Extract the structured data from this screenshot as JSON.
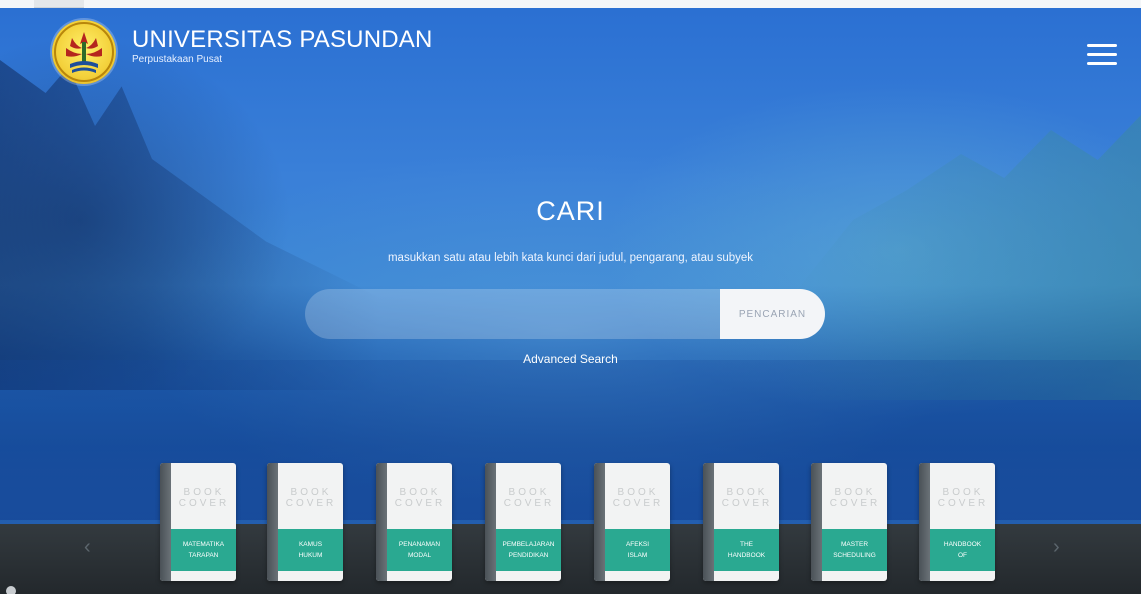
{
  "header": {
    "title": "UNIVERSITAS PASUNDAN",
    "subtitle": "Perpustakaan Pusat",
    "logo_icon": "university-emblem-icon",
    "menu_icon": "hamburger-menu-icon"
  },
  "search": {
    "heading": "CARI",
    "instructions": "masukkan satu atau lebih kata kunci dari judul, pengarang, atau subyek",
    "input_value": "",
    "button_label": "PENCARIAN",
    "advanced_link": "Advanced Search"
  },
  "books": [
    {
      "cover_line1": "BOOK",
      "cover_line2": "COVER",
      "title_line1": "MATEMATIKA",
      "title_line2": "TARAPAN"
    },
    {
      "cover_line1": "BOOK",
      "cover_line2": "COVER",
      "title_line1": "KAMUS",
      "title_line2": "HUKUM"
    },
    {
      "cover_line1": "BOOK",
      "cover_line2": "COVER",
      "title_line1": "PENANAMAN",
      "title_line2": "MODAL"
    },
    {
      "cover_line1": "BOOK",
      "cover_line2": "COVER",
      "title_line1": "PEMBELAJARAN",
      "title_line2": "PENDIDIKAN"
    },
    {
      "cover_line1": "BOOK",
      "cover_line2": "COVER",
      "title_line1": "AFEKSI",
      "title_line2": "ISLAM"
    },
    {
      "cover_line1": "BOOK",
      "cover_line2": "COVER",
      "title_line1": "THE",
      "title_line2": "HANDBOOK"
    },
    {
      "cover_line1": "BOOK",
      "cover_line2": "COVER",
      "title_line1": "MASTER",
      "title_line2": "SCHEDULING"
    },
    {
      "cover_line1": "BOOK",
      "cover_line2": "COVER",
      "title_line1": "HANDBOOK",
      "title_line2": "OF"
    }
  ],
  "shelf": {
    "prev_icon": "chevron-left-icon",
    "next_icon": "chevron-right-icon",
    "prev_glyph": "‹",
    "next_glyph": "›"
  },
  "colors": {
    "background_blue": "#2f6fc8",
    "book_label_green": "#2aa991",
    "shelf_dark": "#2b3136",
    "search_button_bg": "#f3f5f8"
  }
}
